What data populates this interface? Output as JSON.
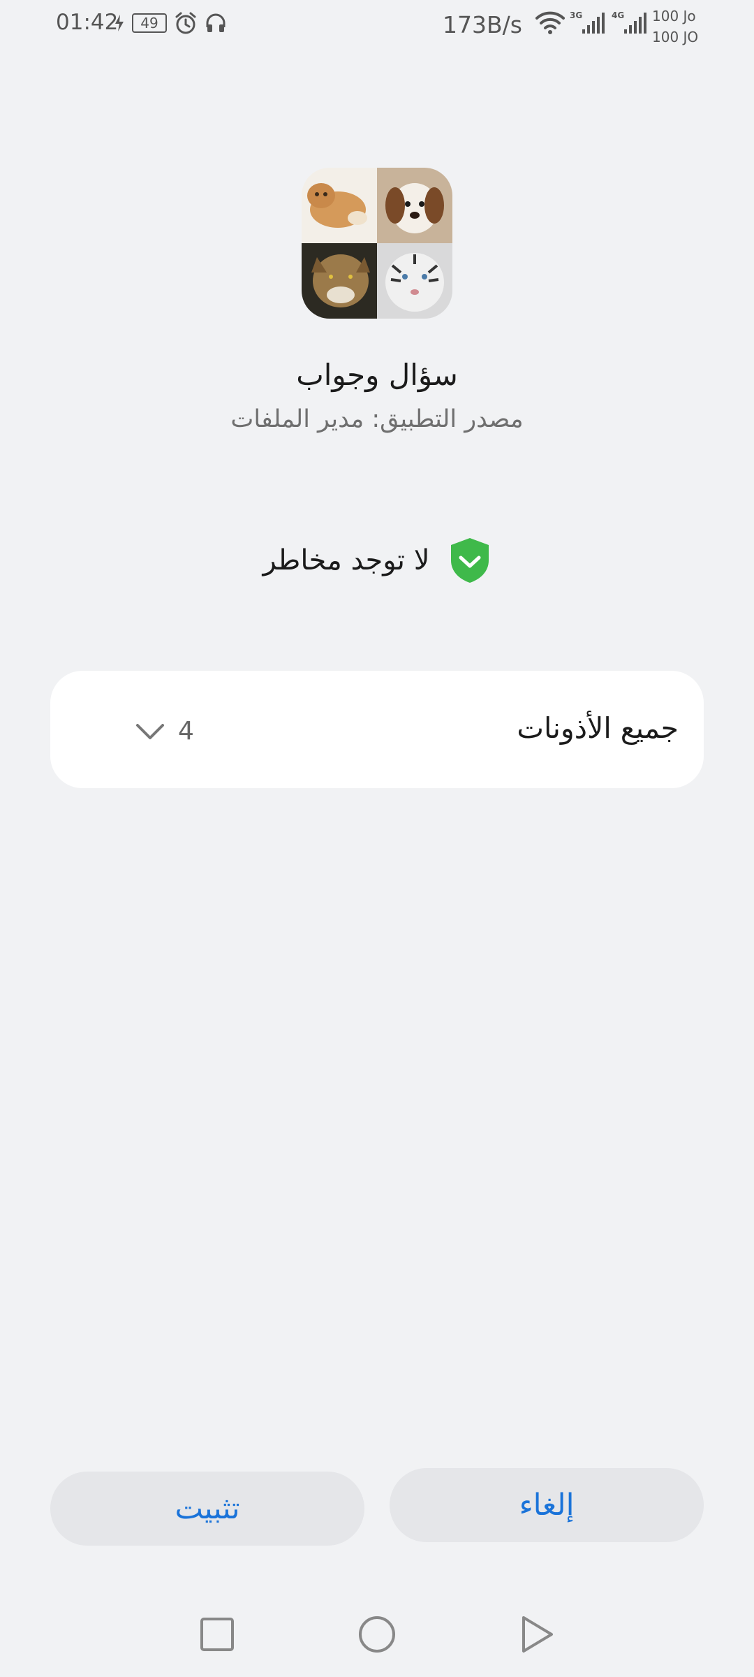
{
  "status_bar": {
    "time": "01:42",
    "battery": "49",
    "net_speed": "173B/s",
    "carrier_1": "100 Jo",
    "carrier_2": "100 JO",
    "icons": [
      "charging-icon",
      "alarm-icon",
      "headset-icon",
      "wifi-icon",
      "signal-3g-icon",
      "signal-4g-icon"
    ]
  },
  "app": {
    "icon": "app-icon-animals-collage",
    "name": "سؤال وجواب",
    "source": "مصدر التطبيق: مدير الملفات"
  },
  "risk": {
    "text": "لا توجد مخاطر",
    "icon": "shield-check-icon",
    "color": "#3fb94a"
  },
  "permissions": {
    "label": "جميع الأذونات",
    "count": "4"
  },
  "buttons": {
    "install": "تثبيت",
    "cancel": "إلغاء",
    "accent": "#1a73d9"
  },
  "navigation": {
    "icons": [
      "recent-apps-icon",
      "home-icon",
      "back-icon"
    ]
  }
}
